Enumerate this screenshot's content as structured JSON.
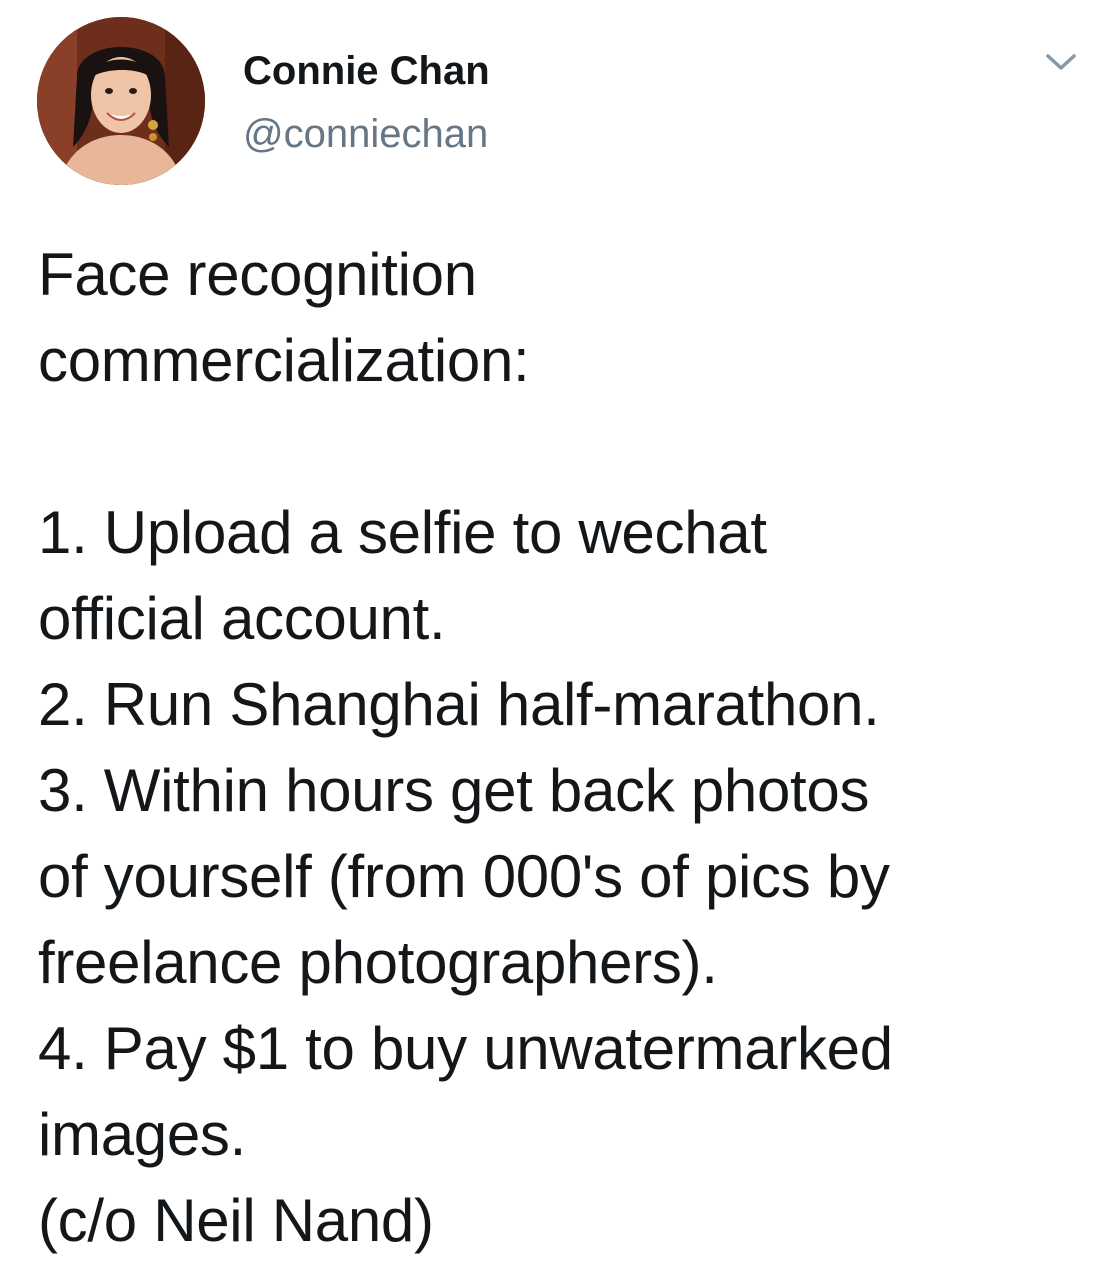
{
  "author": {
    "display_name": "Connie Chan",
    "handle": "@conniechan"
  },
  "icons": {
    "menu": "chevron-down-icon",
    "avatar": "profile-photo"
  },
  "tweet": {
    "lines": [
      "Face recognition",
      "commercialization:",
      "",
      "1. Upload a selfie to wechat",
      "official account.",
      "2. Run Shanghai half-marathon.",
      "3. Within hours get back photos",
      "of yourself (from 000's of pics by",
      "freelance photographers).",
      "4. Pay $1 to buy unwatermarked",
      "images.",
      "(c/o Neil Nand)"
    ]
  },
  "colors": {
    "name": "#14171a",
    "handle": "#657786",
    "caret": "#8899a6",
    "background": "#ffffff"
  }
}
